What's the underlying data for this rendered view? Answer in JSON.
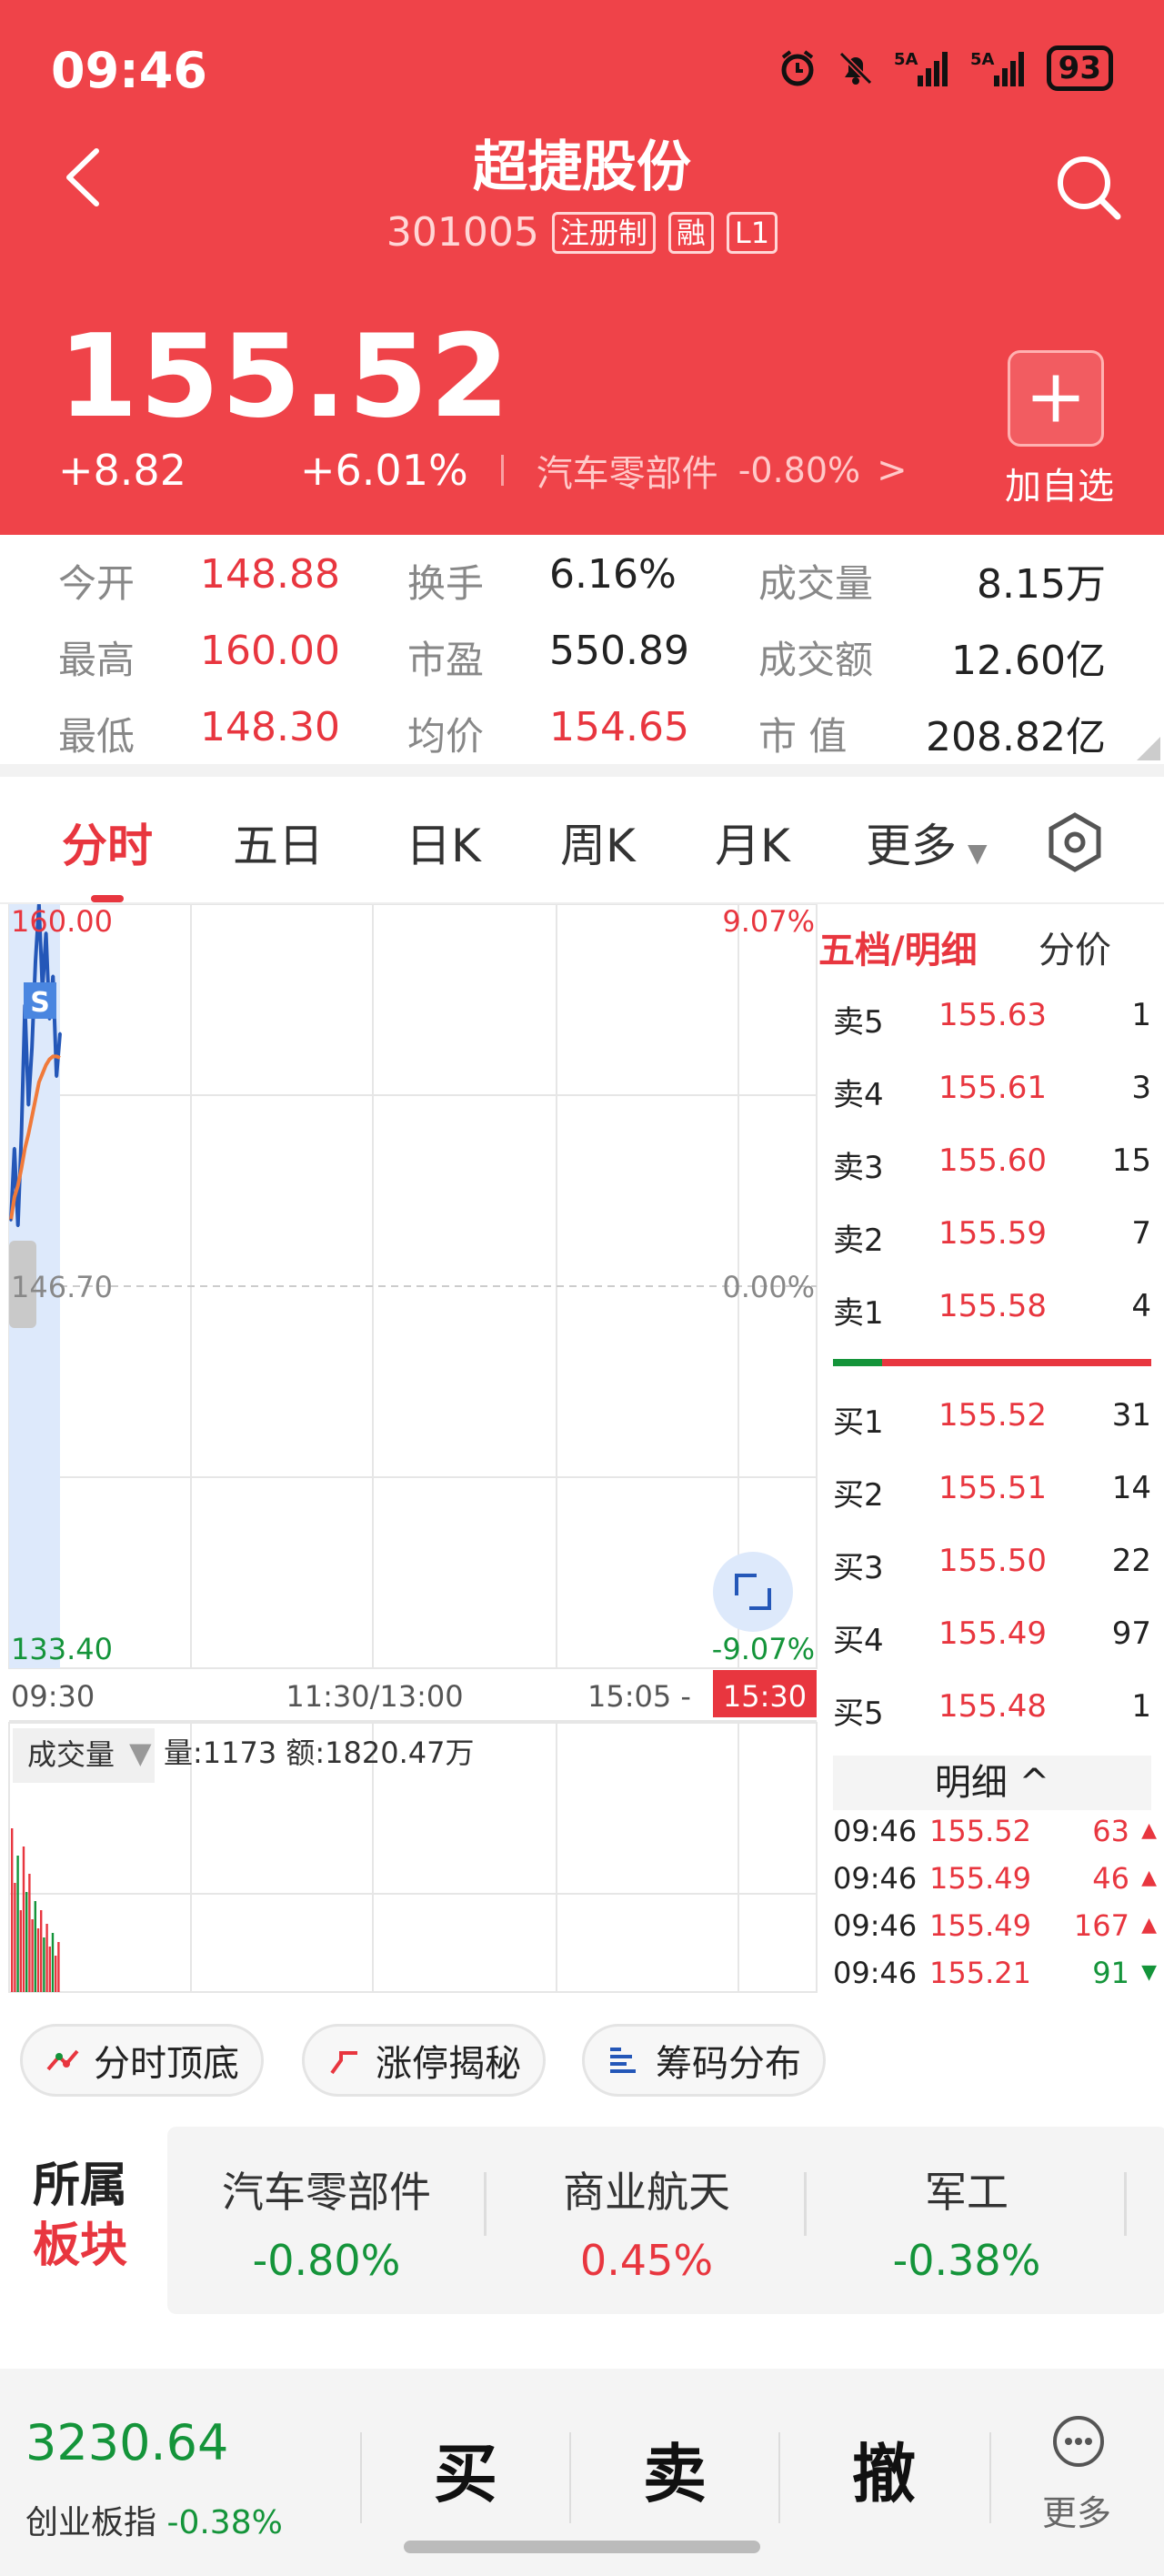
{
  "status": {
    "time": "09:46",
    "signal1": "5A",
    "signal2": "5A",
    "battery": "93"
  },
  "stock": {
    "name": "超捷股份",
    "code": "301005",
    "tags": [
      "注册制",
      "融",
      "L1"
    ],
    "price": "155.52",
    "change_abs": "+8.82",
    "change_pct": "+6.01%",
    "sector_name": "汽车零部件",
    "sector_pct": "-0.80%",
    "sector_arrow": ">",
    "add_label": "加自选"
  },
  "stats": [
    {
      "label": "今开",
      "value": "148.88"
    },
    {
      "label": "换手",
      "value": "6.16%"
    },
    {
      "label": "成交量",
      "value": "8.15万"
    },
    {
      "label": "最高",
      "value": "160.00"
    },
    {
      "label": "市盈",
      "value": "550.89"
    },
    {
      "label": "成交额",
      "value": "12.60亿"
    },
    {
      "label": "最低",
      "value": "148.30"
    },
    {
      "label": "均价",
      "value": "154.65"
    },
    {
      "label": "市 值",
      "value": "208.82亿"
    }
  ],
  "tabs": [
    "分时",
    "五日",
    "日K",
    "周K",
    "月K",
    "更多"
  ],
  "chart": {
    "y_top": "160.00",
    "y_mid": "146.70",
    "y_bot": "133.40",
    "pct_top": "9.07%",
    "pct_mid": "0.00%",
    "pct_bot": "-9.07%",
    "x_start": "09:30",
    "x_mid": "11:30/13:00",
    "x_end": "15:05 -",
    "x_close": "15:30",
    "s_marker": "S",
    "vol_tab": "成交量",
    "vol_info": "量:1173 额:1820.47万"
  },
  "chart_data": {
    "type": "line",
    "title": "",
    "ylim": [
      133.4,
      160.0
    ],
    "series": [
      {
        "values": [
          149.0,
          151.5,
          148.8,
          152.0,
          156.5,
          153.0,
          155.0,
          158.0,
          160.0,
          157.0,
          159.0,
          156.0,
          157.5,
          154.0,
          155.5
        ]
      },
      {
        "values": [
          149.0,
          149.8,
          150.2,
          150.8,
          151.5,
          152.0,
          152.6,
          153.2,
          153.8,
          154.1,
          154.4,
          154.6,
          154.7,
          154.7,
          154.65
        ]
      }
    ]
  },
  "book": {
    "title": "五档/明细",
    "tab2": "分价",
    "asks": [
      {
        "label": "卖5",
        "price": "155.63",
        "vol": "1"
      },
      {
        "label": "卖4",
        "price": "155.61",
        "vol": "3"
      },
      {
        "label": "卖3",
        "price": "155.60",
        "vol": "15"
      },
      {
        "label": "卖2",
        "price": "155.59",
        "vol": "7"
      },
      {
        "label": "卖1",
        "price": "155.58",
        "vol": "4"
      }
    ],
    "bids": [
      {
        "label": "买1",
        "price": "155.52",
        "vol": "31"
      },
      {
        "label": "买2",
        "price": "155.51",
        "vol": "14"
      },
      {
        "label": "买3",
        "price": "155.50",
        "vol": "22"
      },
      {
        "label": "买4",
        "price": "155.49",
        "vol": "97"
      },
      {
        "label": "买5",
        "price": "155.48",
        "vol": "1"
      }
    ],
    "detail_label": "明细 ^",
    "ticks": [
      {
        "time": "09:46",
        "price": "155.52",
        "vol": "63",
        "dir": "up"
      },
      {
        "time": "09:46",
        "price": "155.49",
        "vol": "46",
        "dir": "up"
      },
      {
        "time": "09:46",
        "price": "155.49",
        "vol": "167",
        "dir": "up"
      },
      {
        "time": "09:46",
        "price": "155.21",
        "vol": "91",
        "dir": "down"
      }
    ]
  },
  "tools": [
    "分时顶底",
    "涨停揭秘",
    "筹码分布"
  ],
  "sectors": {
    "title_a": "所属",
    "title_b": "板块",
    "items": [
      {
        "name": "汽车零部件",
        "pct": "-0.80%"
      },
      {
        "name": "商业航天",
        "pct": "0.45%"
      },
      {
        "name": "军工",
        "pct": "-0.38%"
      }
    ]
  },
  "bottom": {
    "index_value": "3230.64",
    "index_name": "创业板指",
    "index_pct": "-0.38%",
    "buy": "买",
    "sell": "卖",
    "cancel": "撤",
    "more": "更多"
  },
  "colors": {
    "brand_red": "#ef4349",
    "up_red": "#e8363f",
    "down_green": "#14943a"
  }
}
